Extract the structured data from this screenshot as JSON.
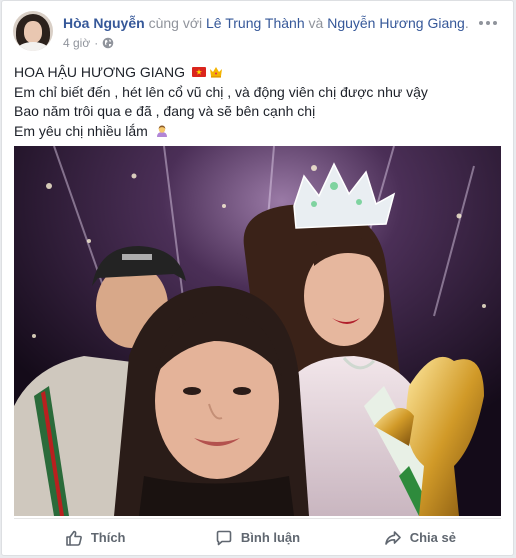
{
  "header": {
    "author": "Hòa Nguyễn",
    "with_text": "cùng với",
    "tagged_1": "Lê Trung Thành",
    "and_text": "và",
    "tagged_2": "Nguyễn Hương Giang",
    "period": ".",
    "time": "4 giờ",
    "separator": "·",
    "privacy_icon": "globe-icon"
  },
  "post": {
    "lines": [
      "HOA HẬU HƯƠNG GIANG",
      "Em chỉ biết đến , hét lên cổ vũ chị , và động viên chị được như vậy",
      "Bao năm trôi qua e đã , đang và sẽ bên cạnh chị",
      "Em yêu chị nhiều lắm"
    ],
    "emojis": [
      "vietnam-flag-emoji",
      "crown-emoji",
      "woman-tipping-hand-emoji"
    ]
  },
  "actions": {
    "like": "Thích",
    "comment": "Bình luận",
    "share": "Chia sẻ"
  },
  "colors": {
    "link": "#365899",
    "muted": "#90949c",
    "action_text": "#606770"
  }
}
